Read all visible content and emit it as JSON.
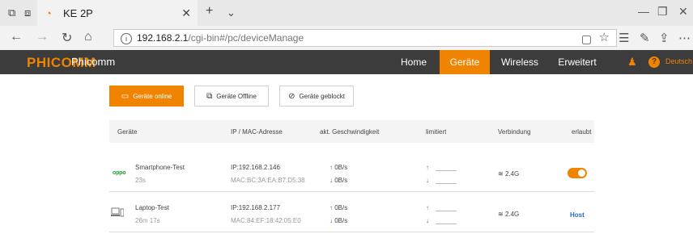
{
  "browser": {
    "tab_title": "KE 2P",
    "url_host": "192.168.2.1",
    "url_path": "/cgi-bin#/pc/deviceManage"
  },
  "router": {
    "logo": "PHICOMM",
    "brand": "Phicomm",
    "menu": [
      "Home",
      "Geräte",
      "Wireless",
      "Erweitert"
    ],
    "active_menu": "Geräte",
    "language": "Deutsch"
  },
  "filters": {
    "online": "Geräte online",
    "offline": "Geräte Offline",
    "blocked": "Geräte geblockt"
  },
  "table": {
    "headers": [
      "Geräte",
      "IP / MAC-Adresse",
      "akt. Geschwindigkeit",
      "limitiert",
      "Verbindung",
      "erlaubt"
    ],
    "rows": [
      {
        "icon": "oppo-logo",
        "logo_text": "oppo",
        "name": "Smartphone-Test",
        "time": "23s",
        "ip": "IP:192.168.2.146",
        "mac": "MAC:BC:3A:EA:B7:D5:38",
        "up": "0B/s",
        "down": "0B/s",
        "connection": "2.4G",
        "allowed": true
      },
      {
        "icon": "laptop-icon",
        "name": "Laptop-Test",
        "time": "26m 17s",
        "ip": "IP:192.168.2.177",
        "mac": "MAC:84:EF:18:42:05:E0",
        "up": "0B/s",
        "down": "0B/s",
        "connection": "2.4G",
        "allowed_label": "Host"
      }
    ]
  },
  "colors": {
    "accent": "#f08300",
    "header_bg": "#3c3c3c",
    "link_blue": "#2468c8"
  }
}
